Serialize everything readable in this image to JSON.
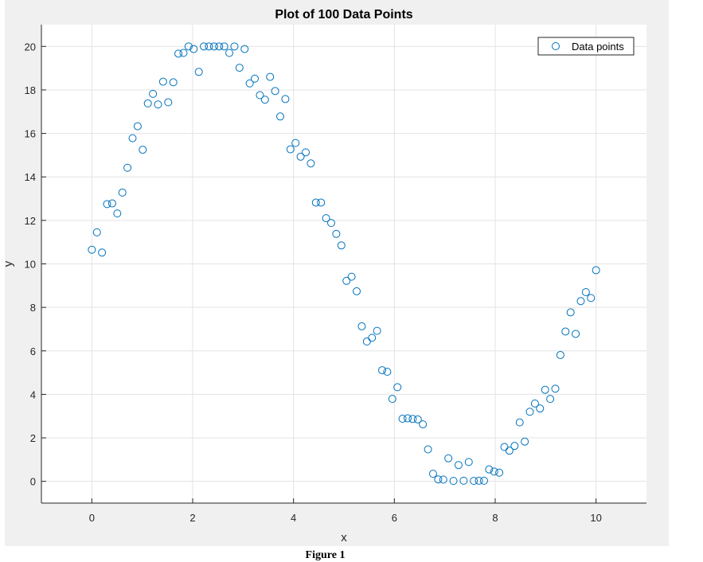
{
  "figure": {
    "caption": "Figure 1",
    "colors": {
      "background": "#f0f0f0",
      "axes_background": "#ffffff",
      "grid": "#e3e3e3",
      "axis": "#262626",
      "marker": "#0072bd"
    }
  },
  "chart_data": {
    "type": "scatter",
    "title": "Plot of 100 Data Points",
    "xlabel": "x",
    "ylabel": "y",
    "xlim": [
      -1,
      11
    ],
    "ylim": [
      -1,
      21
    ],
    "xticks": [
      0,
      2,
      4,
      6,
      8,
      10
    ],
    "yticks": [
      0,
      2,
      4,
      6,
      8,
      10,
      12,
      14,
      16,
      18,
      20
    ],
    "grid": true,
    "legend": {
      "position": "top-right",
      "entries": [
        "Data points"
      ]
    },
    "marker": "circle",
    "series": [
      {
        "name": "Data points",
        "color": "#0072bd",
        "x": [
          0.0,
          0.101,
          0.202,
          0.303,
          0.404,
          0.505,
          0.606,
          0.707,
          0.808,
          0.909,
          1.01,
          1.111,
          1.212,
          1.313,
          1.414,
          1.515,
          1.616,
          1.717,
          1.818,
          1.919,
          2.02,
          2.121,
          2.222,
          2.323,
          2.424,
          2.525,
          2.626,
          2.727,
          2.828,
          2.929,
          3.03,
          3.131,
          3.232,
          3.333,
          3.434,
          3.535,
          3.636,
          3.737,
          3.838,
          3.939,
          4.04,
          4.141,
          4.242,
          4.343,
          4.444,
          4.545,
          4.646,
          4.747,
          4.848,
          4.949,
          5.051,
          5.152,
          5.253,
          5.354,
          5.455,
          5.556,
          5.657,
          5.758,
          5.859,
          5.96,
          6.061,
          6.162,
          6.263,
          6.364,
          6.465,
          6.566,
          6.667,
          6.768,
          6.869,
          6.97,
          7.071,
          7.172,
          7.273,
          7.374,
          7.475,
          7.576,
          7.677,
          7.778,
          7.879,
          7.98,
          8.081,
          8.182,
          8.283,
          8.384,
          8.485,
          8.586,
          8.687,
          8.788,
          8.889,
          8.99,
          9.091,
          9.192,
          9.293,
          9.394,
          9.495,
          9.596,
          9.697,
          9.798,
          9.899,
          10.0
        ],
        "y": [
          10.65,
          11.45,
          10.52,
          12.75,
          12.78,
          12.32,
          13.28,
          14.42,
          15.78,
          16.33,
          15.25,
          17.38,
          17.82,
          17.33,
          18.38,
          17.43,
          18.35,
          19.67,
          19.7,
          20.0,
          19.88,
          18.83,
          20.0,
          20.0,
          20.0,
          20.0,
          20.0,
          19.7,
          20.0,
          19.02,
          19.88,
          18.3,
          18.52,
          17.76,
          17.55,
          18.6,
          17.95,
          16.78,
          17.58,
          15.27,
          15.56,
          14.93,
          15.13,
          14.62,
          12.82,
          12.82,
          12.1,
          11.88,
          11.38,
          10.85,
          9.22,
          9.41,
          8.74,
          7.13,
          6.43,
          6.6,
          6.92,
          5.11,
          5.04,
          3.79,
          4.33,
          2.88,
          2.9,
          2.87,
          2.85,
          2.62,
          1.47,
          0.35,
          0.09,
          0.08,
          1.06,
          0.02,
          0.75,
          0.03,
          0.89,
          0.02,
          0.03,
          0.03,
          0.55,
          0.45,
          0.4,
          1.58,
          1.41,
          1.63,
          2.71,
          1.83,
          3.2,
          3.58,
          3.35,
          4.21,
          3.79,
          4.26,
          5.81,
          6.89,
          7.77,
          6.78,
          8.29,
          8.7,
          8.43,
          9.71
        ]
      }
    ]
  }
}
